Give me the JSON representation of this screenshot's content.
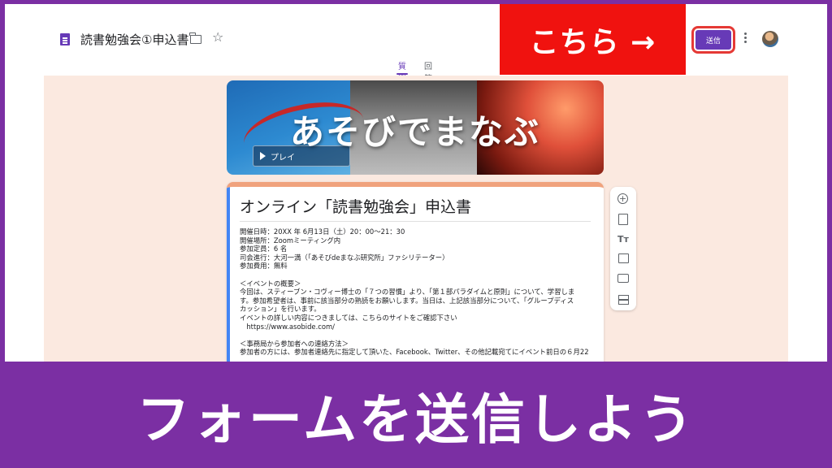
{
  "header": {
    "doc_title": "読書勉強会①申込書",
    "send_label": "送信",
    "icons": [
      "form-doc-icon",
      "folder-icon",
      "star-icon",
      "more-icon"
    ]
  },
  "tabs": [
    {
      "label": "質問",
      "active": true
    },
    {
      "label": "回答",
      "active": false
    }
  ],
  "callout": {
    "text": "こちら →",
    "color": "#f0120f"
  },
  "banner": {
    "text": "あそびでまなぶ",
    "play_label": "プレイ"
  },
  "form": {
    "title": "オンライン「読書勉強会」申込書",
    "description": [
      "開催日時：20XX 年 6月13日（土）20：00～21：30",
      "開催場所：Zoomミーティング内",
      "参加定員：6 名",
      "司会進行：大河一満（「あそびdeまなぶ研究所」ファシリテーター）",
      "参加費用：無料",
      "",
      "＜イベントの概要＞",
      "今回は、スティーブン・コヴィー博士の「７つの習慣」より、「第１部パラダイムと原則」について、学習しま",
      "す。参加希望者は、事前に該当部分の熟読をお願いします。当日は、上記該当部分について、「グループディス",
      "カッション」を行います。",
      "イベントの詳しい内容につきましては、こちらのサイトをご確認下さい",
      "　https://www.asobide.com/",
      "",
      "＜事務局から参加者への連絡方法＞",
      "参加者の方には、参加者連絡先に指定して頂いた、Facebook、Twitter、その他記載宛てにイベント前日の６月22"
    ]
  },
  "toolbar": [
    "add-question-icon",
    "import-questions-icon",
    "add-title-icon",
    "add-image-icon",
    "add-video-icon",
    "add-section-icon"
  ],
  "caption": "フォームを送信しよう",
  "colors": {
    "frame": "#7b2fa3",
    "accent": "#673ab7",
    "canvas": "#fbe9e0",
    "highlight": "#e53935"
  }
}
